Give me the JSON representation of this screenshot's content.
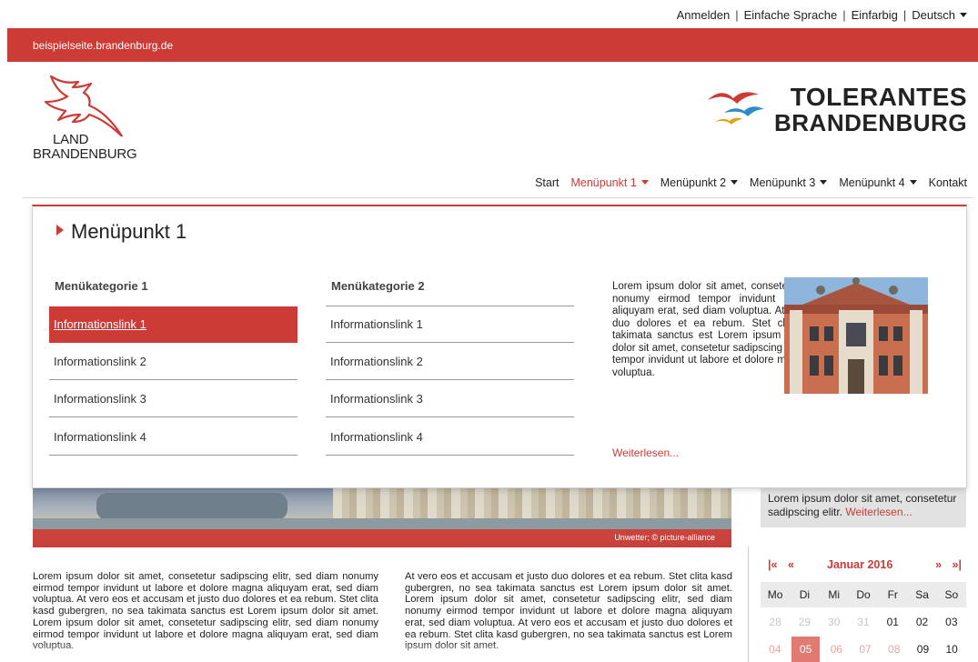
{
  "utility": {
    "login": "Anmelden",
    "simple_language": "Einfache Sprache",
    "monochrome": "Einfarbig",
    "language": "Deutsch"
  },
  "site": {
    "domain": "beispielseite.brandenburg.de",
    "land_logo_line1": "LAND",
    "land_logo_line2": "BRANDENBURG",
    "partner_logo_line1": "TOLERANTES",
    "partner_logo_line2": "BRANDENBURG",
    "accent_color": "#cc3b36"
  },
  "nav": {
    "items": [
      {
        "label": "Start",
        "dropdown": false,
        "active": false
      },
      {
        "label": "Menüpunkt 1",
        "dropdown": true,
        "active": true
      },
      {
        "label": "Menüpunkt 2",
        "dropdown": true,
        "active": false
      },
      {
        "label": "Menüpunkt 3",
        "dropdown": true,
        "active": false
      },
      {
        "label": "Menüpunkt 4",
        "dropdown": true,
        "active": false
      },
      {
        "label": "Kontakt",
        "dropdown": false,
        "active": false
      }
    ]
  },
  "mega_menu": {
    "title": "Menüpunkt 1",
    "categories": [
      {
        "title": "Menükategorie 1",
        "links": [
          "Informationslink 1",
          "Informationslink 2",
          "Informationslink 3",
          "Informationslink 4"
        ],
        "active_index": 0
      },
      {
        "title": "Menükategorie 2",
        "links": [
          "Informationslink 1",
          "Informationslink 2",
          "Informationslink 3",
          "Informationslink 4"
        ],
        "active_index": -1
      }
    ],
    "teaser": {
      "text": "Lorem ipsum dolor sit amet, consetetur sadipscing elitr, sed diam nonumy eirmod tempor invidunt ut labore et dolore magna aliquyam erat, sed diam voluptua. At vero eos et accusam et justo duo dolores et ea rebum. Stet clita kasd gubergren, no sea takimata sanctus est Lorem ipsum dolor sit amet. Lorem ipsum dolor sit amet, consetetur sadipscing elitr, sed diam nonumy eirmod tempor invidunt ut labore et dolore magna aliquyam erat, sed diam voluptua.",
      "more": "Weiterlesen..."
    }
  },
  "hero": {
    "caption": "Unwetter; © picture-alliance"
  },
  "sidebar_teaser": {
    "text": "Lorem ipsum dolor sit amet, consetetur sadipscing elitr.",
    "more": "Weiterlesen..."
  },
  "calendar": {
    "first": "|«",
    "prev": "«",
    "month": "Januar 2016",
    "next": "»",
    "last": "»|",
    "weekdays": [
      "Mo",
      "Di",
      "Mi",
      "Do",
      "Fr",
      "Sa",
      "So"
    ],
    "row1": [
      "28",
      "29",
      "30",
      "31",
      "01",
      "02",
      "03"
    ],
    "row2": [
      "04",
      "05",
      "06",
      "07",
      "08",
      "09",
      "10"
    ],
    "today": "05"
  },
  "content": {
    "col1": "Lorem ipsum dolor sit amet, consetetur sadipscing elitr, sed diam nonumy eirmod tempor invidunt ut labore et dolore magna aliquyam erat, sed diam voluptua. At vero eos et accusam et justo duo dolores et ea rebum. Stet clita kasd gubergren, no sea takimata sanctus est Lorem ipsum dolor sit amet. Lorem ipsum dolor sit amet, consetetur sadipscing elitr, sed diam nonumy eirmod tempor invidunt ut labore et dolore magna aliquyam erat, sed diam voluptua.",
    "col2": "At vero eos et accusam et justo duo dolores et ea rebum. Stet clita kasd gubergren, no sea takimata sanctus est Lorem ipsum dolor sit amet. Lorem ipsum dolor sit amet, consetetur sadipscing elitr, sed diam nonumy eirmod tempor invidunt ut labore et dolore magna aliquyam erat, sed diam voluptua. At vero eos et accusam et justo duo dolores et ea rebum. Stet clita kasd gubergren, no sea takimata sanctus est Lorem ipsum dolor sit amet."
  }
}
